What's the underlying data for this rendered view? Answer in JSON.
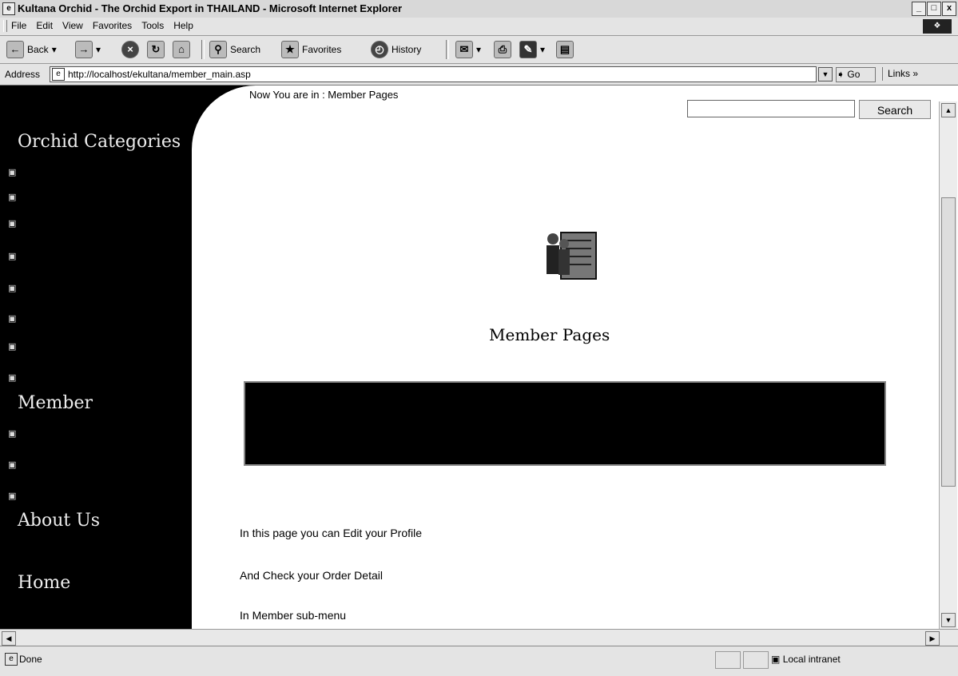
{
  "window": {
    "title": "Kultana Orchid - The Orchid Export in THAILAND - Microsoft Internet Explorer",
    "controls": {
      "minimize": "_",
      "maximize": "□",
      "close": "x"
    }
  },
  "menu": {
    "items": [
      "File",
      "Edit",
      "View",
      "Favorites",
      "Tools",
      "Help"
    ]
  },
  "toolbar": {
    "back": "Back",
    "search": "Search",
    "favorites": "Favorites",
    "history": "History"
  },
  "address": {
    "label": "Address",
    "url": "http://localhost/ekultana/member_main.asp",
    "go": "Go",
    "links": "Links"
  },
  "sidebar": {
    "categories_heading": "Orchid Categories",
    "member_heading": "Member",
    "about_heading": "About Us",
    "home_heading": "Home"
  },
  "content": {
    "breadcrumb": "Now You are in : Member Pages",
    "search_button": "Search",
    "member_title": "Member Pages",
    "lines": [
      "In this page you can Edit your Profile",
      "And Check your Order Detail",
      "In Member sub-menu"
    ]
  },
  "status": {
    "text": "Done",
    "zone": "Local intranet"
  },
  "colors": {
    "sidebar_bg": "#000000",
    "page_bg": "#ffffff",
    "chrome_bg": "#e4e4e4"
  },
  "icons": [
    "ie-logo-icon",
    "back-arrow-icon",
    "forward-arrow-icon",
    "stop-icon",
    "refresh-icon",
    "home-icon",
    "search-icon",
    "favorites-icon",
    "history-icon",
    "mail-icon",
    "print-icon",
    "edit-icon",
    "discuss-icon",
    "member-people-icon"
  ]
}
